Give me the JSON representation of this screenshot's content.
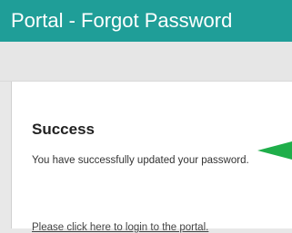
{
  "header": {
    "title": "Portal - Forgot Password",
    "background": "#1f9e98"
  },
  "status": {
    "title": "Success",
    "message": "You have successfully updated your password."
  },
  "login_link": {
    "text": "Please click here to login to the portal."
  },
  "annotation": {
    "icon": "left-arrow-icon",
    "color": "#1fae4a"
  }
}
